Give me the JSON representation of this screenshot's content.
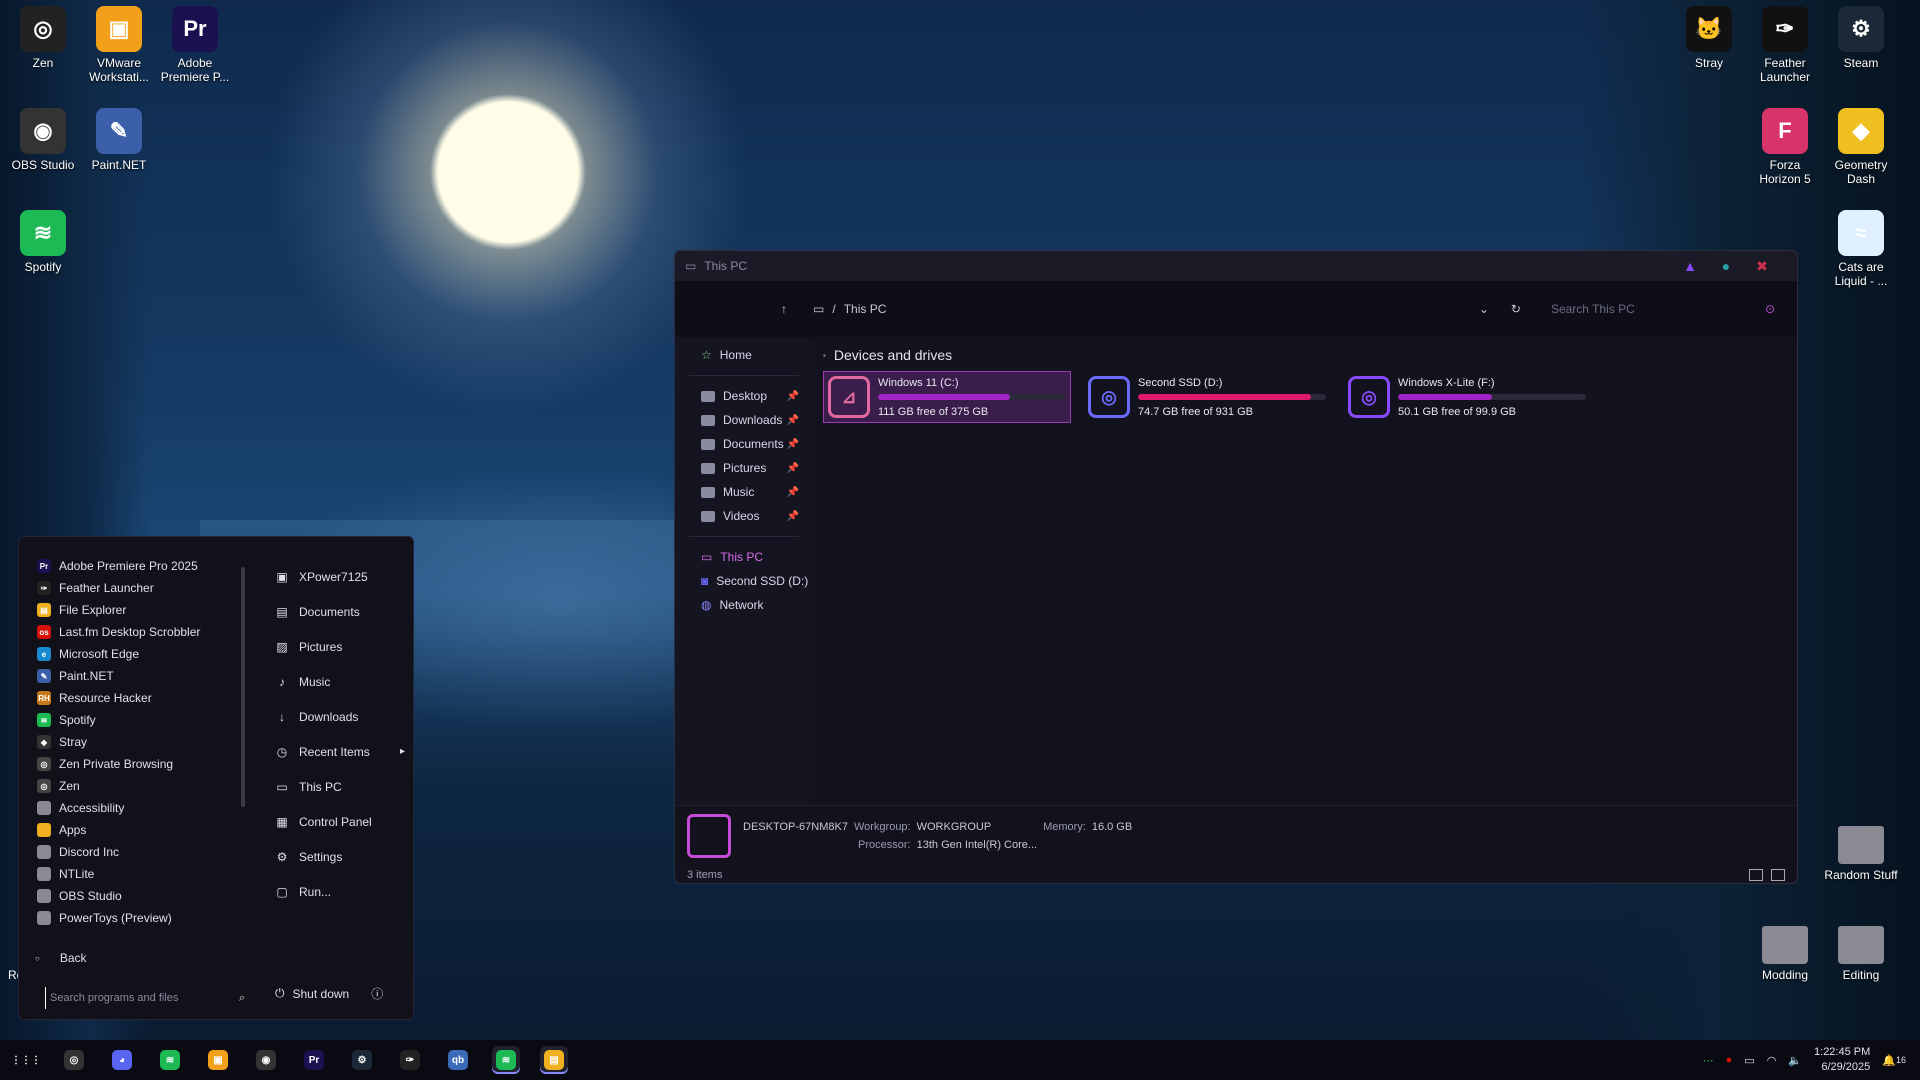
{
  "desktop_icons": [
    {
      "label": "Zen",
      "glyph": "◎",
      "color": "#222222"
    },
    {
      "label": "VMware Workstati...",
      "glyph": "▣",
      "color": "#f2a01a"
    },
    {
      "label": "Adobe Premiere P...",
      "glyph": "Pr",
      "color": "#1a1250"
    },
    {
      "label": "OBS Studio",
      "glyph": "◉",
      "color": "#333333"
    },
    {
      "label": "Paint.NET",
      "glyph": "✎",
      "color": "#3b5fa8"
    },
    {
      "label": "Spotify",
      "glyph": "≋",
      "color": "#1db954"
    },
    {
      "label": "Stray",
      "glyph": "🐱",
      "color": "#111111"
    },
    {
      "label": "Feather Launcher",
      "glyph": "✑",
      "color": "#111111"
    },
    {
      "label": "Steam",
      "glyph": "⚙",
      "color": "#1b2838"
    },
    {
      "label": "Forza Horizon 5",
      "glyph": "F",
      "color": "#d8336a"
    },
    {
      "label": "Geometry Dash",
      "glyph": "◆",
      "color": "#f0c020"
    },
    {
      "label": "Cats are Liquid - ...",
      "glyph": "≈",
      "color": "#dfefff"
    },
    {
      "label": "Random Stuff",
      "glyph": "",
      "color": "#8a8a94"
    },
    {
      "label": "Modding",
      "glyph": "",
      "color": "#8a8a94"
    },
    {
      "label": "Editing",
      "glyph": "",
      "color": "#8a8a94"
    }
  ],
  "desktop_partial_label": "Re",
  "explorer": {
    "title": "This PC",
    "address_sep": "/",
    "address": "This PC",
    "search_placeholder": "Search This PC",
    "nav": {
      "home": "Home",
      "pinned": [
        "Desktop",
        "Downloads",
        "Documents",
        "Pictures",
        "Music",
        "Videos"
      ],
      "this_pc": "This PC",
      "second_ssd": "Second SSD (D:)",
      "network": "Network"
    },
    "section_title": "Devices and drives",
    "drives": [
      {
        "name": "Windows 11 (C:)",
        "free": "111 GB free of 375 GB",
        "used_fraction": 0.7,
        "color": "#e06aa0",
        "bar_color": "#a024c8"
      },
      {
        "name": "Second SSD (D:)",
        "free": "74.7 GB free of 931 GB",
        "used_fraction": 0.92,
        "color": "#6a6aff",
        "bar_color": "#e01a6a"
      },
      {
        "name": "Windows X-Lite (F:)",
        "free": "50.1 GB free of 99.9 GB",
        "used_fraction": 0.5,
        "color": "#8a4aff",
        "bar_color": "#a024c8"
      }
    ],
    "details": {
      "computer": "DESKTOP-67NM8K7",
      "workgroup_label": "Workgroup:",
      "workgroup": "WORKGROUP",
      "memory_label": "Memory:",
      "memory": "16.0 GB",
      "processor_label": "Processor:",
      "processor": "13th Gen Intel(R) Core..."
    },
    "status": "3 items"
  },
  "start_menu": {
    "programs": [
      {
        "label": "Adobe Premiere Pro 2025",
        "glyph": "Pr",
        "color": "#1a1250"
      },
      {
        "label": "Feather Launcher",
        "glyph": "✑",
        "color": "#222222"
      },
      {
        "label": "File Explorer",
        "glyph": "▤",
        "color": "#f0b020"
      },
      {
        "label": "Last.fm Desktop Scrobbler",
        "glyph": "os",
        "color": "#d51007"
      },
      {
        "label": "Microsoft Edge",
        "glyph": "e",
        "color": "#1a8ad0"
      },
      {
        "label": "Paint.NET",
        "glyph": "✎",
        "color": "#3b5fa8"
      },
      {
        "label": "Resource Hacker",
        "glyph": "RH",
        "color": "#c87a1a"
      },
      {
        "label": "Spotify",
        "glyph": "≋",
        "color": "#1db954"
      },
      {
        "label": "Stray",
        "glyph": "◆",
        "color": "#333333"
      },
      {
        "label": "Zen Private Browsing",
        "glyph": "◎",
        "color": "#444444"
      },
      {
        "label": "Zen",
        "glyph": "◎",
        "color": "#444444"
      },
      {
        "label": "Accessibility",
        "glyph": "",
        "color": "#8a8a94"
      },
      {
        "label": "Apps",
        "glyph": "",
        "color": "#f0b020"
      },
      {
        "label": "Discord Inc",
        "glyph": "",
        "color": "#8a8a94"
      },
      {
        "label": "NTLite",
        "glyph": "",
        "color": "#8a8a94"
      },
      {
        "label": "OBS Studio",
        "glyph": "",
        "color": "#8a8a94"
      },
      {
        "label": "PowerToys (Preview)",
        "glyph": "",
        "color": "#8a8a94"
      }
    ],
    "places": [
      {
        "label": "XPower7125",
        "glyph": "▣"
      },
      {
        "label": "Documents",
        "glyph": "▤"
      },
      {
        "label": "Pictures",
        "glyph": "▨"
      },
      {
        "label": "Music",
        "glyph": "♪"
      },
      {
        "label": "Downloads",
        "glyph": "↓"
      },
      {
        "label": "Recent Items",
        "glyph": "◷"
      },
      {
        "label": "This PC",
        "glyph": "▭"
      },
      {
        "label": "Control Panel",
        "glyph": "▦"
      },
      {
        "label": "Settings",
        "glyph": "⚙"
      },
      {
        "label": "Run...",
        "glyph": "▢"
      }
    ],
    "back": "Back",
    "search_placeholder": "Search programs and files",
    "shutdown": "Shut down"
  },
  "taskbar": {
    "apps": [
      {
        "name": "apps-grid",
        "glyph": "⋮⋮⋮",
        "color": "transparent",
        "open": false
      },
      {
        "name": "zen",
        "glyph": "◎",
        "color": "#333333",
        "open": false
      },
      {
        "name": "discord",
        "glyph": "◕",
        "color": "#5865f2",
        "open": false
      },
      {
        "name": "spotify",
        "glyph": "≋",
        "color": "#1db954",
        "open": false
      },
      {
        "name": "vmware",
        "glyph": "▣",
        "color": "#f2a01a",
        "open": false
      },
      {
        "name": "obs",
        "glyph": "◉",
        "color": "#333333",
        "open": false
      },
      {
        "name": "premiere",
        "glyph": "Pr",
        "color": "#1a1250",
        "open": false
      },
      {
        "name": "steam",
        "glyph": "⚙",
        "color": "#1b2838",
        "open": false
      },
      {
        "name": "feather",
        "glyph": "✑",
        "color": "#222222",
        "open": false
      },
      {
        "name": "qbittorrent",
        "glyph": "qb",
        "color": "#3a6ab8",
        "open": false
      },
      {
        "name": "spotify-open",
        "glyph": "≋",
        "color": "#1db954",
        "open": true
      },
      {
        "name": "file-explorer",
        "glyph": "▤",
        "color": "#f0b020",
        "open": true
      }
    ],
    "time": "1:22:45 PM",
    "date": "6/29/2025",
    "notifications": "16"
  }
}
